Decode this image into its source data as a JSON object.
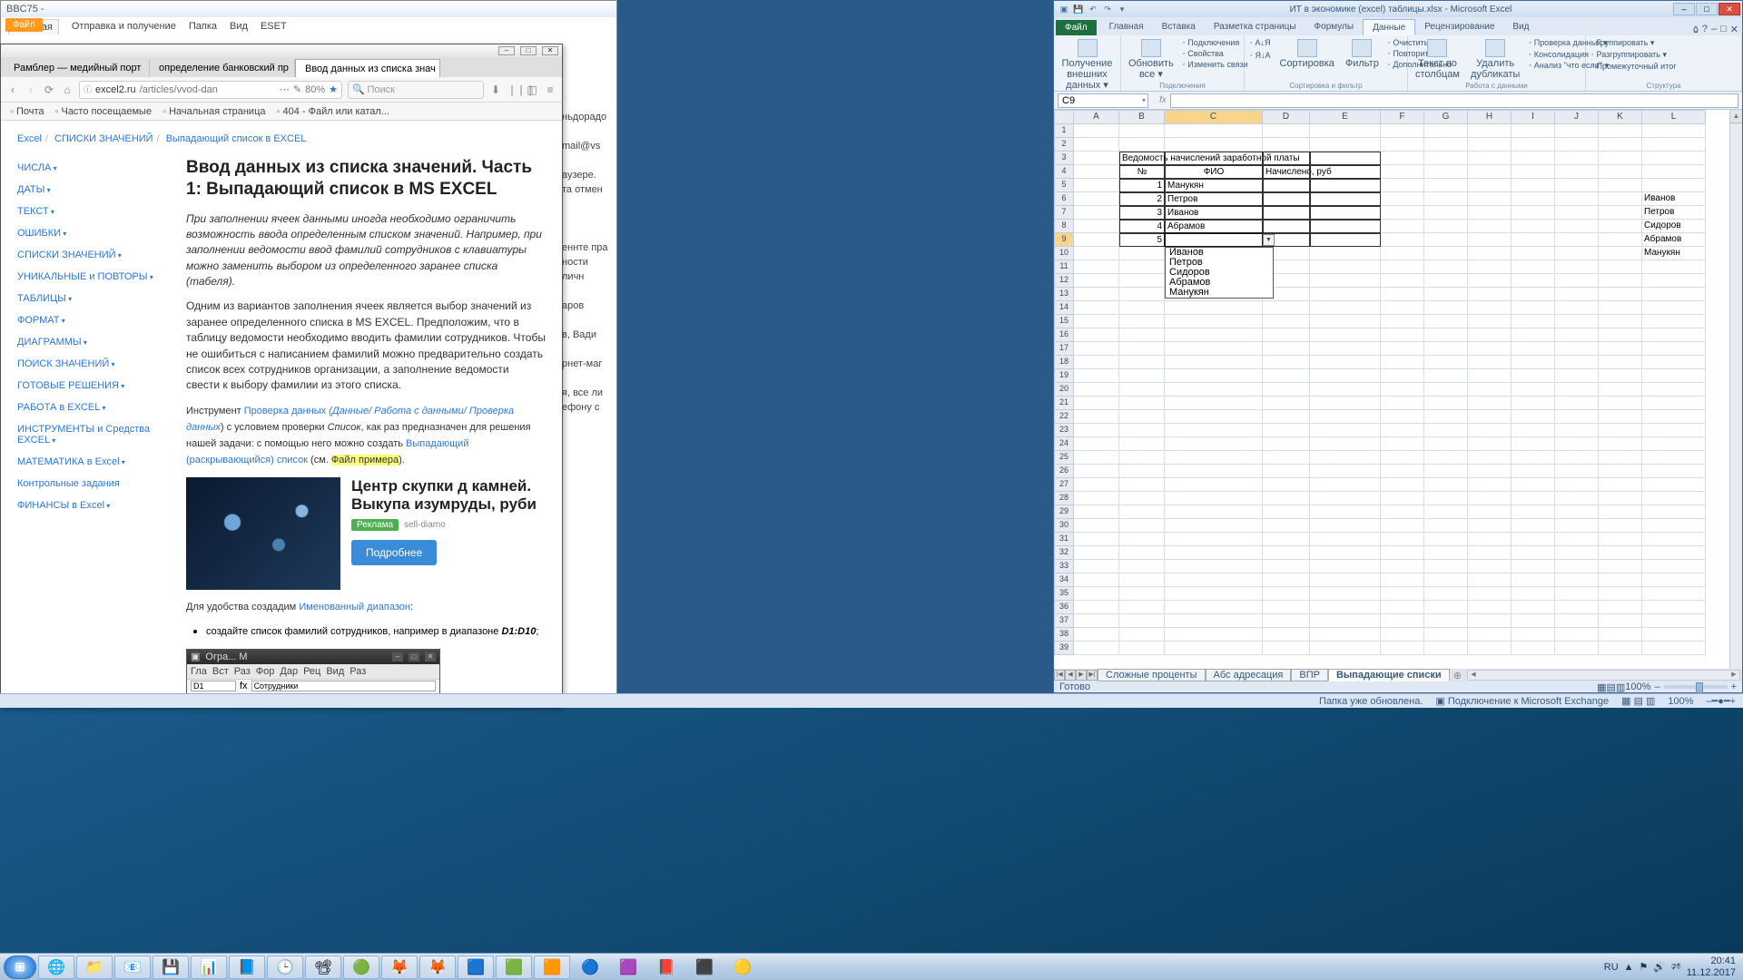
{
  "outlook": {
    "title": "BBC75 -",
    "file": "Файл",
    "tabs": [
      "Главная",
      "Отправка и получение",
      "Папка",
      "Вид",
      "ESET"
    ],
    "side": [
      "ньдорадо",
      "mail@vs",
      "аузере.",
      "та отмен",
      "еннте пра",
      "ности личн",
      "аров",
      "в, Вади",
      "рнет-маг",
      "я, все ли",
      "ефону с"
    ]
  },
  "browser": {
    "tabs": [
      {
        "title": "Рамблер — медийный порт",
        "active": false
      },
      {
        "title": "определение банковский пр",
        "active": false
      },
      {
        "title": "Ввод данных из списка знач",
        "active": true
      }
    ],
    "url_host": "excel2.ru",
    "url_path": "/articles/vvod-dan",
    "search_ph": "Поиск",
    "bookmarks": [
      "Почта",
      "Часто посещаемые",
      "Начальная страница",
      "404 - Файл или катал..."
    ],
    "crumbs": [
      "Excel",
      "СПИСКИ ЗНАЧЕНИЙ",
      "Выпадающий список в EXCEL"
    ],
    "nav": [
      "ЧИСЛА",
      "ДАТЫ",
      "ТЕКСТ",
      "ОШИБКИ",
      "СПИСКИ ЗНАЧЕНИЙ",
      "УНИКАЛЬНЫЕ и ПОВТОРЫ",
      "ТАБЛИЦЫ",
      "ФОРМАТ",
      "ДИАГРАММЫ",
      "ПОИСК ЗНАЧЕНИЙ",
      "ГОТОВЫЕ РЕШЕНИЯ",
      "РАБОТА в EXCEL",
      "ИНСТРУМЕНТЫ и Средства EXCEL",
      "МАТЕМАТИКА в Excel",
      "Контрольные задания",
      "ФИНАНСЫ в Excel"
    ],
    "nav_plain": [
      14
    ],
    "h1": "Ввод данных из списка значений. Часть 1: Выпадающий список в MS EXCEL",
    "p1": "При заполнении ячеек данными иногда необходимо ограничить возможность ввода определенным списком значений. Например, при заполнении ведомости ввод фамилий сотрудников с клавиатуры можно заменить выбором из определенного заранее списка (табеля).",
    "p2": "Одним из вариантов заполнения ячеек является выбор значений из заранее определенного списка в MS EXCEL. Предположим, что в таблицу ведомости необходимо вводить фамилии сотрудников. Чтобы не ошибиться с написанием фамилий можно предварительно создать список всех сотрудников организации, а заполнение ведомости свести к выбору фамилии из этого списка.",
    "p3_a": "Инструмент ",
    "p3_l1": "Проверка данных",
    "p3_l2": " (Данные/ Работа с данными/ Проверка данных",
    "p3_b": ") с условием проверки ",
    "p3_i": "Список",
    "p3_c": ", как раз предназначен для решения нашей задачи: с помощью него можно создать ",
    "p3_l3": "Выпадающий (раскрывающийся) список",
    "p3_d": " (см. ",
    "p3_hl": "Файл примера",
    "p3_e": ").",
    "ad_h": "Центр скупки д камней. Выкупа изумруды, руби",
    "ad_badge": "Реклама",
    "ad_dom": "sell-diamo",
    "ad_btn": "Подробнее",
    "p4_a": "Для удобства создадим ",
    "p4_l": "Именованный диапазон",
    "p4_b": ":",
    "li1_a": "создайте список фамилий сотрудников, например в диапазоне ",
    "li1_b": "D1:D10",
    "li1_c": ";",
    "mini": {
      "title": "Огра... M",
      "tabs": [
        "Гла",
        "Вст",
        "Раз",
        "Фор",
        "Дар",
        "Рец",
        "Вид",
        "Раз"
      ],
      "name": "D1",
      "fx": "Сотрудники"
    }
  },
  "excel": {
    "title": "ИТ в экономике (excel) таблицы.xlsx - Microsoft Excel",
    "file": "Файл",
    "tabs": [
      "Главная",
      "Вставка",
      "Разметка страницы",
      "Формулы",
      "Данные",
      "Рецензирование",
      "Вид"
    ],
    "tab_active": 4,
    "ribbon": {
      "g1": {
        "b1": "Получение внешних данных ▾"
      },
      "g2": {
        "b1": "Обновить все ▾",
        "s": [
          "Подключения",
          "Свойства",
          "Изменить связи"
        ],
        "lbl": "Подключения"
      },
      "g3": {
        "az": "А↓Я",
        "za": "Я↓А",
        "sort": "Сортировка",
        "filter": "Фильтр",
        "s": [
          "Очистить",
          "Повторить",
          "Дополнительно"
        ],
        "lbl": "Сортировка и фильтр"
      },
      "g4": {
        "b1": "Текст по столбцам",
        "b2": "Удалить дубликаты",
        "s": [
          "Проверка данных ▾",
          "Консолидация",
          "Анализ \"что если\" ▾"
        ],
        "lbl": "Работа с данными"
      },
      "g5": {
        "s": [
          "Группировать ▾",
          "Разгруппировать ▾",
          "Промежуточный итог"
        ],
        "lbl": "Структура"
      }
    },
    "namebox": "C9",
    "cols": [
      "A",
      "B",
      "C",
      "D",
      "E",
      "F",
      "G",
      "H",
      "I",
      "J",
      "K",
      "L"
    ],
    "table": {
      "title": "Ведомость начислений заработной платы",
      "h": [
        "№",
        "ФИО",
        "Начислено, руб"
      ],
      "rows": [
        {
          "n": "1",
          "f": "Манукян"
        },
        {
          "n": "2",
          "f": "Петров"
        },
        {
          "n": "3",
          "f": "Иванов"
        },
        {
          "n": "4",
          "f": "Абрамов"
        },
        {
          "n": "5",
          "f": ""
        }
      ]
    },
    "dropdown": [
      "Иванов",
      "Петров",
      "Сидоров",
      "Абрамов",
      "Манукян"
    ],
    "sideL": [
      "Иванов",
      "Петров",
      "Сидоров",
      "Абрамов",
      "Манукян"
    ],
    "sheets": [
      "Сложные проценты",
      "Абс адресация",
      "ВПР",
      "Выпадающие списки"
    ],
    "sheet_active": 3,
    "status": "Готово",
    "zoom": "100%"
  },
  "olstatus": {
    "a": "Папка уже обновлена.",
    "b": "Подключение к Microsoft Exchange",
    "z": "100%"
  },
  "taskbar": {
    "icons": [
      "🌐",
      "📁",
      "📧",
      "💾",
      "📊",
      "📘",
      "🕒",
      "📽",
      "🟢",
      "🦊",
      "🦊",
      "🟦",
      "🟩",
      "🟧",
      "🔵",
      "🟪",
      "📕",
      "⬛",
      "🟡"
    ],
    "lang": "RU",
    "time": "20:41",
    "date": "11.12.2017"
  }
}
